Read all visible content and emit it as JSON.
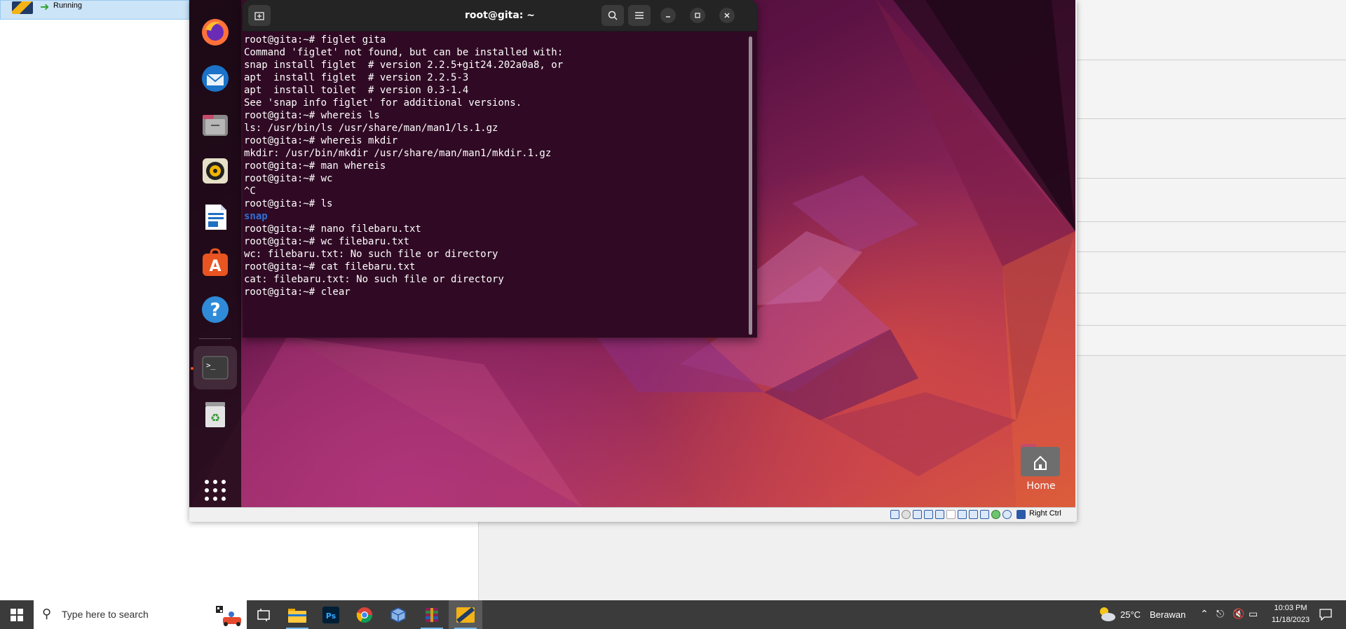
{
  "vbox_manager": {
    "vm_state": "Running"
  },
  "terminal": {
    "title": "root@gita: ~",
    "lines": [
      "root@gita:~# figlet gita",
      "Command 'figlet' not found, but can be installed with:",
      "snap install figlet  # version 2.2.5+git24.202a0a8, or",
      "apt  install figlet  # version 2.2.5-3",
      "apt  install toilet  # version 0.3-1.4",
      "See 'snap info figlet' for additional versions.",
      "root@gita:~# whereis ls",
      "ls: /usr/bin/ls /usr/share/man/man1/ls.1.gz",
      "root@gita:~# whereis mkdir",
      "mkdir: /usr/bin/mkdir /usr/share/man/man1/mkdir.1.gz",
      "root@gita:~# man whereis",
      "root@gita:~# wc",
      "^C",
      "root@gita:~# ls",
      "snap",
      "root@gita:~# nano filebaru.txt",
      "root@gita:~# wc filebaru.txt",
      "wc: filebaru.txt: No such file or directory",
      "root@gita:~# cat filebaru.txt",
      "cat: filebaru.txt: No such file or directory",
      "root@gita:~# clear"
    ],
    "highlight_line_index": 14,
    "highlight_color": "#2f6fd6"
  },
  "desktop": {
    "home_label": "Home"
  },
  "dock": {
    "items": [
      "firefox-icon",
      "thunderbird-icon",
      "files-icon",
      "rhythmbox-icon",
      "libreoffice-writer-icon",
      "app-center-icon",
      "help-icon",
      "terminal-icon",
      "trash-icon",
      "show-apps-icon"
    ]
  },
  "vm_status": {
    "host_key": "Right Ctrl"
  },
  "taskbar": {
    "search_placeholder": "Type here to search",
    "weather_temp": "25°C",
    "weather_desc": "Berawan",
    "time": "10:03 PM",
    "date": "11/18/2023"
  },
  "colors": {
    "terminal_bg": "#300a24",
    "ubuntu_orange": "#e95420",
    "taskbar_bg": "#3b3b3b"
  }
}
